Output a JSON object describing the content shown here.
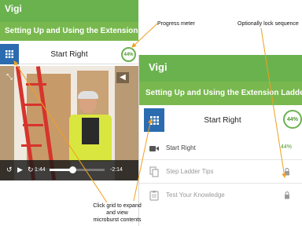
{
  "left_screen": {
    "logo": "Vigi",
    "title": "Setting Up and Using the Extension Ladder",
    "nav_title": "Start Right",
    "progress": "44%",
    "video": {
      "current_time": "1:44",
      "remaining_time": "-2:14",
      "progress_fraction": 0.42
    }
  },
  "right_screen": {
    "logo": "Vigi",
    "title": "Setting Up and Using the Extension Ladder",
    "nav_title": "Start Right",
    "progress": "44%",
    "items": [
      {
        "label": "Start Right",
        "value": "44%",
        "icon": "video-camera-icon",
        "locked": false
      },
      {
        "label": "Step Ladder Tips",
        "icon": "copy-icon",
        "locked": true
      },
      {
        "label": "Test Your Knowledge",
        "icon": "clipboard-icon",
        "locked": true
      }
    ]
  },
  "annotations": {
    "progress_meter": "Progress meter",
    "lock_sequence": "Optionally lock sequence",
    "grid_note_line1": "Click grid to expand",
    "grid_note_line2": "and view",
    "grid_note_line3": "microburst contents"
  },
  "colors": {
    "brand_green": "#6ab24e",
    "title_green": "#79b84f",
    "grid_blue": "#2b6cb0",
    "arrow_orange": "#f0a020"
  }
}
